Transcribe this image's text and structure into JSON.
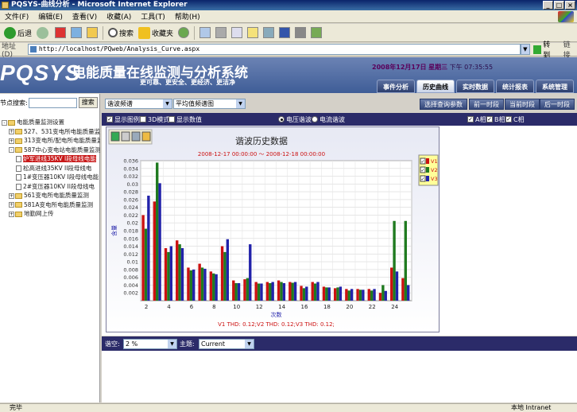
{
  "window": {
    "title": "PQSYS-曲线分析 - Microsoft Internet Explorer"
  },
  "menu": [
    "文件(F)",
    "编辑(E)",
    "查看(V)",
    "收藏(A)",
    "工具(T)",
    "帮助(H)"
  ],
  "toolbar": {
    "back": "后退",
    "search": "搜索",
    "favorites": "收藏夹"
  },
  "address": {
    "label": "地址(D)",
    "url": "http://localhost/PQweb/Analysis_Curve.aspx",
    "go": "转到",
    "links": "链接"
  },
  "banner": {
    "logo": "PQSYS",
    "title": "电能质量在线监测与分析系统",
    "slogan": "更可靠、更安全、更经济、更洁净",
    "date": "2008年12月17日",
    "weekday": "星期三",
    "time": "下午 07:35:55",
    "tabs": [
      "事件分析",
      "历史曲线",
      "实时数据",
      "统计报表",
      "系统管理"
    ],
    "active_tab": "历史曲线"
  },
  "sidebar": {
    "search_label": "节点搜索:",
    "search_button": "搜索",
    "tree": [
      {
        "label": "电能质量监测设置",
        "level": 0,
        "kind": "folder",
        "sign": "-"
      },
      {
        "label": "527、531变电所电能质量监测",
        "level": 1,
        "kind": "folder",
        "sign": "+"
      },
      {
        "label": "313变电所/配电所电能质量监测",
        "level": 1,
        "kind": "folder",
        "sign": "+"
      },
      {
        "label": "587中心变电站电能质量监测",
        "level": 1,
        "kind": "folder",
        "sign": "-"
      },
      {
        "label": "炉军进线35KV I段母线电能",
        "level": 2,
        "kind": "doc",
        "selected": true
      },
      {
        "label": "松高进线35KV II段母线电",
        "level": 2,
        "kind": "doc"
      },
      {
        "label": "1#变压器10KV I段母线电能",
        "level": 2,
        "kind": "doc"
      },
      {
        "label": "2#变压器10KV II段母线电",
        "level": 2,
        "kind": "doc"
      },
      {
        "label": "561变电所电能质量监测",
        "level": 1,
        "kind": "folder",
        "sign": "+"
      },
      {
        "label": "581A变电所电能质量监测",
        "level": 1,
        "kind": "folder",
        "sign": "+"
      },
      {
        "label": "地勤网上传",
        "level": 1,
        "kind": "folder",
        "sign": "+"
      }
    ]
  },
  "controls": {
    "select1": "谐波频谱",
    "select2": "平均值频谱图",
    "buttons": [
      "选择查询参数",
      "前一时段",
      "当前时段",
      "后一时段"
    ]
  },
  "options": {
    "show_legend": "显示图例",
    "mode_3d": "3D模式",
    "show_values": "显示数值",
    "voltage": "电压谐波",
    "current": "电流谐波",
    "phase_a": "A相",
    "phase_b": "B相",
    "phase_c": "C相"
  },
  "chart_data": {
    "type": "bar",
    "title": "谐波历史数据",
    "subtitle": "2008-12-17 00:00:00 ～ 2008-12-18 00:00:00",
    "xlabel": "次数",
    "ylabel": "含量",
    "footer": "V1 THD: 0.12;V2 THD: 0.12;V3 THD: 0.12;",
    "ylim": [
      0,
      0.036
    ],
    "yticks": [
      "0.036",
      "0.034",
      "0.032",
      "0.03",
      "0.028",
      "0.026",
      "0.024",
      "0.022",
      "0.02",
      "0.018",
      "0.016",
      "0.014",
      "0.012",
      "0.01",
      "0.008",
      "0.006",
      "0.004",
      "0.002"
    ],
    "xtick_labels": [
      "2",
      "4",
      "6",
      "8",
      "10",
      "12",
      "14",
      "16",
      "18",
      "20",
      "22",
      "24"
    ],
    "categories": [
      2,
      3,
      4,
      5,
      6,
      7,
      8,
      9,
      10,
      11,
      12,
      13,
      14,
      15,
      16,
      17,
      18,
      19,
      20,
      21,
      22,
      23,
      24,
      25
    ],
    "series": [
      {
        "name": "V1",
        "color": "#cc1111",
        "values": [
          0.022,
          0.0255,
          0.0135,
          0.0155,
          0.0085,
          0.0095,
          0.0075,
          0.014,
          0.0052,
          0.0055,
          0.0048,
          0.0048,
          0.0052,
          0.0048,
          0.0038,
          0.0048,
          0.0036,
          0.0032,
          0.003,
          0.003,
          0.003,
          0.002,
          0.0085,
          0.0058
        ]
      },
      {
        "name": "V2",
        "color": "#1f7a1f",
        "values": [
          0.0185,
          0.0355,
          0.0125,
          0.0145,
          0.0078,
          0.0085,
          0.007,
          0.0125,
          0.0045,
          0.0058,
          0.0044,
          0.0045,
          0.0048,
          0.0046,
          0.0032,
          0.0044,
          0.0034,
          0.0034,
          0.0026,
          0.0028,
          0.0026,
          0.004,
          0.0205,
          0.0205
        ]
      },
      {
        "name": "V3",
        "color": "#2222aa",
        "values": [
          0.027,
          0.0302,
          0.014,
          0.0135,
          0.008,
          0.0082,
          0.0068,
          0.0158,
          0.0045,
          0.0145,
          0.0044,
          0.0048,
          0.0045,
          0.0048,
          0.0036,
          0.0048,
          0.0034,
          0.0036,
          0.003,
          0.0028,
          0.003,
          0.0025,
          0.0075,
          0.004
        ]
      }
    ],
    "legend": [
      "V1",
      "V2",
      "V3"
    ],
    "legend_position": "right"
  },
  "bottom": {
    "smooth_label": "谐空:",
    "smooth_value": "2 %",
    "theme_label": "主题:",
    "theme_value": "Current"
  },
  "status": {
    "left": "完毕",
    "zone": "本地 Intranet"
  }
}
